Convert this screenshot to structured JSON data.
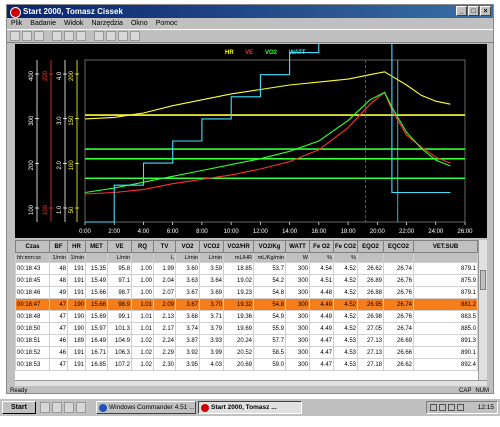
{
  "window": {
    "title": "Start 2000,  Tomasz Cissek",
    "buttons": [
      "_",
      "□",
      "×"
    ]
  },
  "menu": [
    "Plik",
    "Badanie",
    "Widok",
    "Narzędzia",
    "Okno",
    "Pomoc"
  ],
  "toolbar": [
    "new",
    "open",
    "save",
    "print",
    "preview",
    "export",
    "copy",
    "paste",
    "zoom",
    "help"
  ],
  "chart": {
    "legend": [
      {
        "name": "HR",
        "color": "#ffff30"
      },
      {
        "name": "VE",
        "color": "#ff3030"
      },
      {
        "name": "VO2",
        "color": "#30ff30"
      },
      {
        "name": "WATT",
        "color": "#40e0ff"
      }
    ],
    "x_ticks": [
      "0:00",
      "2:00",
      "4:00",
      "6:00",
      "8:00",
      "10:00",
      "12:00",
      "14:00",
      "16:00",
      "18:00",
      "20:00",
      "22:00",
      "24:00",
      "26:00"
    ],
    "axis_ticks": {
      "a1": [
        "400",
        "300",
        "200",
        "100"
      ],
      "a2": [
        "200",
        "100"
      ],
      "a3": [
        "4.0",
        "3.0",
        "2.0",
        "1.0"
      ],
      "a4": [
        "200",
        "150",
        "100",
        "50"
      ]
    }
  },
  "chart_data": {
    "type": "line",
    "x_unit": "minutes",
    "x": [
      0,
      2,
      4,
      6,
      8,
      10,
      12,
      14,
      16,
      18,
      19.5,
      20.5,
      21,
      22,
      23,
      24,
      25
    ],
    "series": [
      {
        "name": "HR",
        "values": [
          140,
          142,
          148,
          158,
          166,
          174,
          180,
          186,
          190,
          194,
          200,
          204,
          198,
          186,
          172,
          164,
          160
        ]
      },
      {
        "name": "VE",
        "values": [
          38,
          40,
          44,
          52,
          58,
          64,
          72,
          82,
          98,
          128,
          160,
          176,
          152,
          118,
          102,
          88,
          80
        ]
      },
      {
        "name": "VO2",
        "values": [
          40,
          46,
          54,
          62,
          70,
          78,
          86,
          96,
          110,
          138,
          166,
          176,
          156,
          122,
          100,
          84,
          76
        ]
      },
      {
        "name": "WATT",
        "values": [
          0,
          50,
          80,
          110,
          140,
          170,
          200,
          230,
          260,
          290,
          300,
          300,
          40,
          40,
          40,
          40,
          40
        ]
      }
    ],
    "reference_lines": {
      "green": [
        0.55,
        0.61,
        0.73
      ],
      "yellow": [
        0.34
      ]
    },
    "markers": {
      "dashed": 19.2,
      "solid": 21.4
    }
  },
  "table": {
    "headers": [
      "Czas",
      "BF",
      "HR",
      "MET",
      "VE",
      "RQ",
      "TV",
      "VO2",
      "VCO2",
      "VO2/HR",
      "VO2/Kg",
      "WATT",
      "Fe O2",
      "Fe CO2",
      "EQO2",
      "EQCO2",
      "VET.SUB"
    ],
    "units": [
      "hh:mm:ss",
      "1/min",
      "1/min",
      "",
      "L/min",
      "",
      "L",
      "L/min",
      "L/min",
      "mL/HR",
      "mL/Kg/min",
      "W",
      "%",
      "%",
      "",
      "",
      ""
    ],
    "rows": [
      [
        "00:18:43",
        "48",
        "191",
        "15.35",
        "95.8",
        "1.00",
        "1.99",
        "3.60",
        "3.59",
        "18.85",
        "53.7",
        "300",
        "4.54",
        "4.52",
        "26.62",
        "26.74",
        "879.1"
      ],
      [
        "00:18:45",
        "48",
        "191",
        "15.49",
        "97.1",
        "1.00",
        "2.04",
        "3.63",
        "3.64",
        "19.02",
        "54.2",
        "300",
        "4.51",
        "4.52",
        "26.89",
        "26.76",
        "875.9"
      ],
      [
        "00:18:46",
        "49",
        "191",
        "15.66",
        "98.7",
        "1.00",
        "2.07",
        "3.67",
        "3.69",
        "19.23",
        "54.8",
        "300",
        "4.48",
        "4.52",
        "26.88",
        "26.76",
        "879.1"
      ],
      [
        "00:18:47",
        "47",
        "190",
        "15.66",
        "98.9",
        "1.01",
        "2.09",
        "3.67",
        "3.70",
        "19.32",
        "54.8",
        "300",
        "4.49",
        "4.52",
        "26.95",
        "26.74",
        "881.2"
      ],
      [
        "00:18:48",
        "47",
        "190",
        "15.69",
        "99.1",
        "1.01",
        "2.13",
        "3.68",
        "3.71",
        "19.36",
        "54.9",
        "300",
        "4.49",
        "4.52",
        "26.98",
        "26.76",
        "883.5"
      ],
      [
        "00:18:50",
        "47",
        "190",
        "15.97",
        "101.3",
        "1.01",
        "2.17",
        "3.74",
        "3.79",
        "19.69",
        "55.9",
        "300",
        "4.49",
        "4.52",
        "27.05",
        "26.74",
        "885.0"
      ],
      [
        "00:18:51",
        "46",
        "189",
        "16.49",
        "104.9",
        "1.02",
        "2.24",
        "3.87",
        "3.93",
        "20.24",
        "57.7",
        "300",
        "4.47",
        "4.53",
        "27.13",
        "26.69",
        "891.3"
      ],
      [
        "00:18:52",
        "46",
        "191",
        "16.71",
        "106.3",
        "1.02",
        "2.29",
        "3.92",
        "3.99",
        "20.52",
        "58.5",
        "300",
        "4.47",
        "4.53",
        "27.13",
        "26.66",
        "890.1"
      ],
      [
        "00:18:53",
        "47",
        "191",
        "16.85",
        "107.2",
        "1.02",
        "2.30",
        "3.95",
        "4.03",
        "20.69",
        "59.0",
        "300",
        "4.47",
        "4.53",
        "27.18",
        "26.62",
        "892.4"
      ]
    ],
    "selected_row": 3
  },
  "status": {
    "left": "Ready",
    "right": [
      "CAP",
      "NUM"
    ]
  },
  "taskbar": {
    "start": "Start",
    "tasks": [
      "Windows Commander 4.51 ...",
      "Start 2000,  Tomasz ..."
    ],
    "clock": "12:15"
  }
}
